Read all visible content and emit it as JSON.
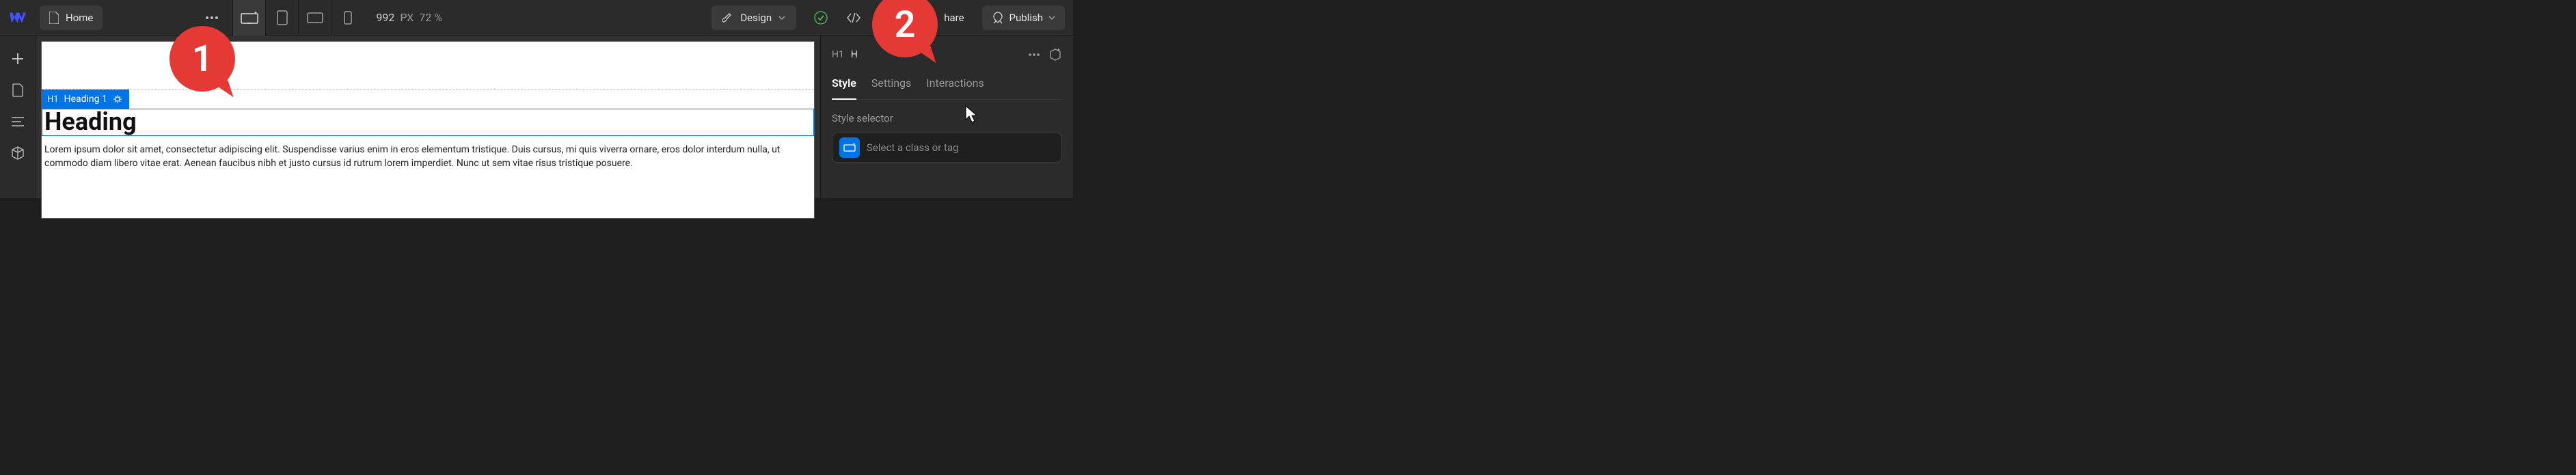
{
  "colors": {
    "brand_blue": "#0073e6",
    "callout_red": "#e53935"
  },
  "topbar": {
    "page_name": "Home",
    "canvas_width": "992",
    "px_label": "PX",
    "zoom": "72 %",
    "design_label": "Design",
    "share_label": "hare",
    "publish_label": "Publish"
  },
  "canvas": {
    "selected_tag": "H1",
    "selected_label": "Heading 1",
    "heading_text": "Heading",
    "paragraph": "Lorem ipsum dolor sit amet, consectetur adipiscing elit. Suspendisse varius enim in eros elementum tristique. Duis cursus, mi quis viverra ornare, eros dolor interdum nulla, ut commodo diam libero vitae erat. Aenean faucibus nibh et justo cursus id rutrum lorem imperdiet. Nunc ut sem vitae risus tristique posuere."
  },
  "rightpanel": {
    "element_tag": "H1",
    "element_name_partial": "H",
    "tabs": {
      "style": "Style",
      "settings": "Settings",
      "interactions": "Interactions"
    },
    "style_selector_label": "Style selector",
    "selector_placeholder": "Select a class or tag"
  },
  "callouts": {
    "one": "1",
    "two": "2"
  }
}
